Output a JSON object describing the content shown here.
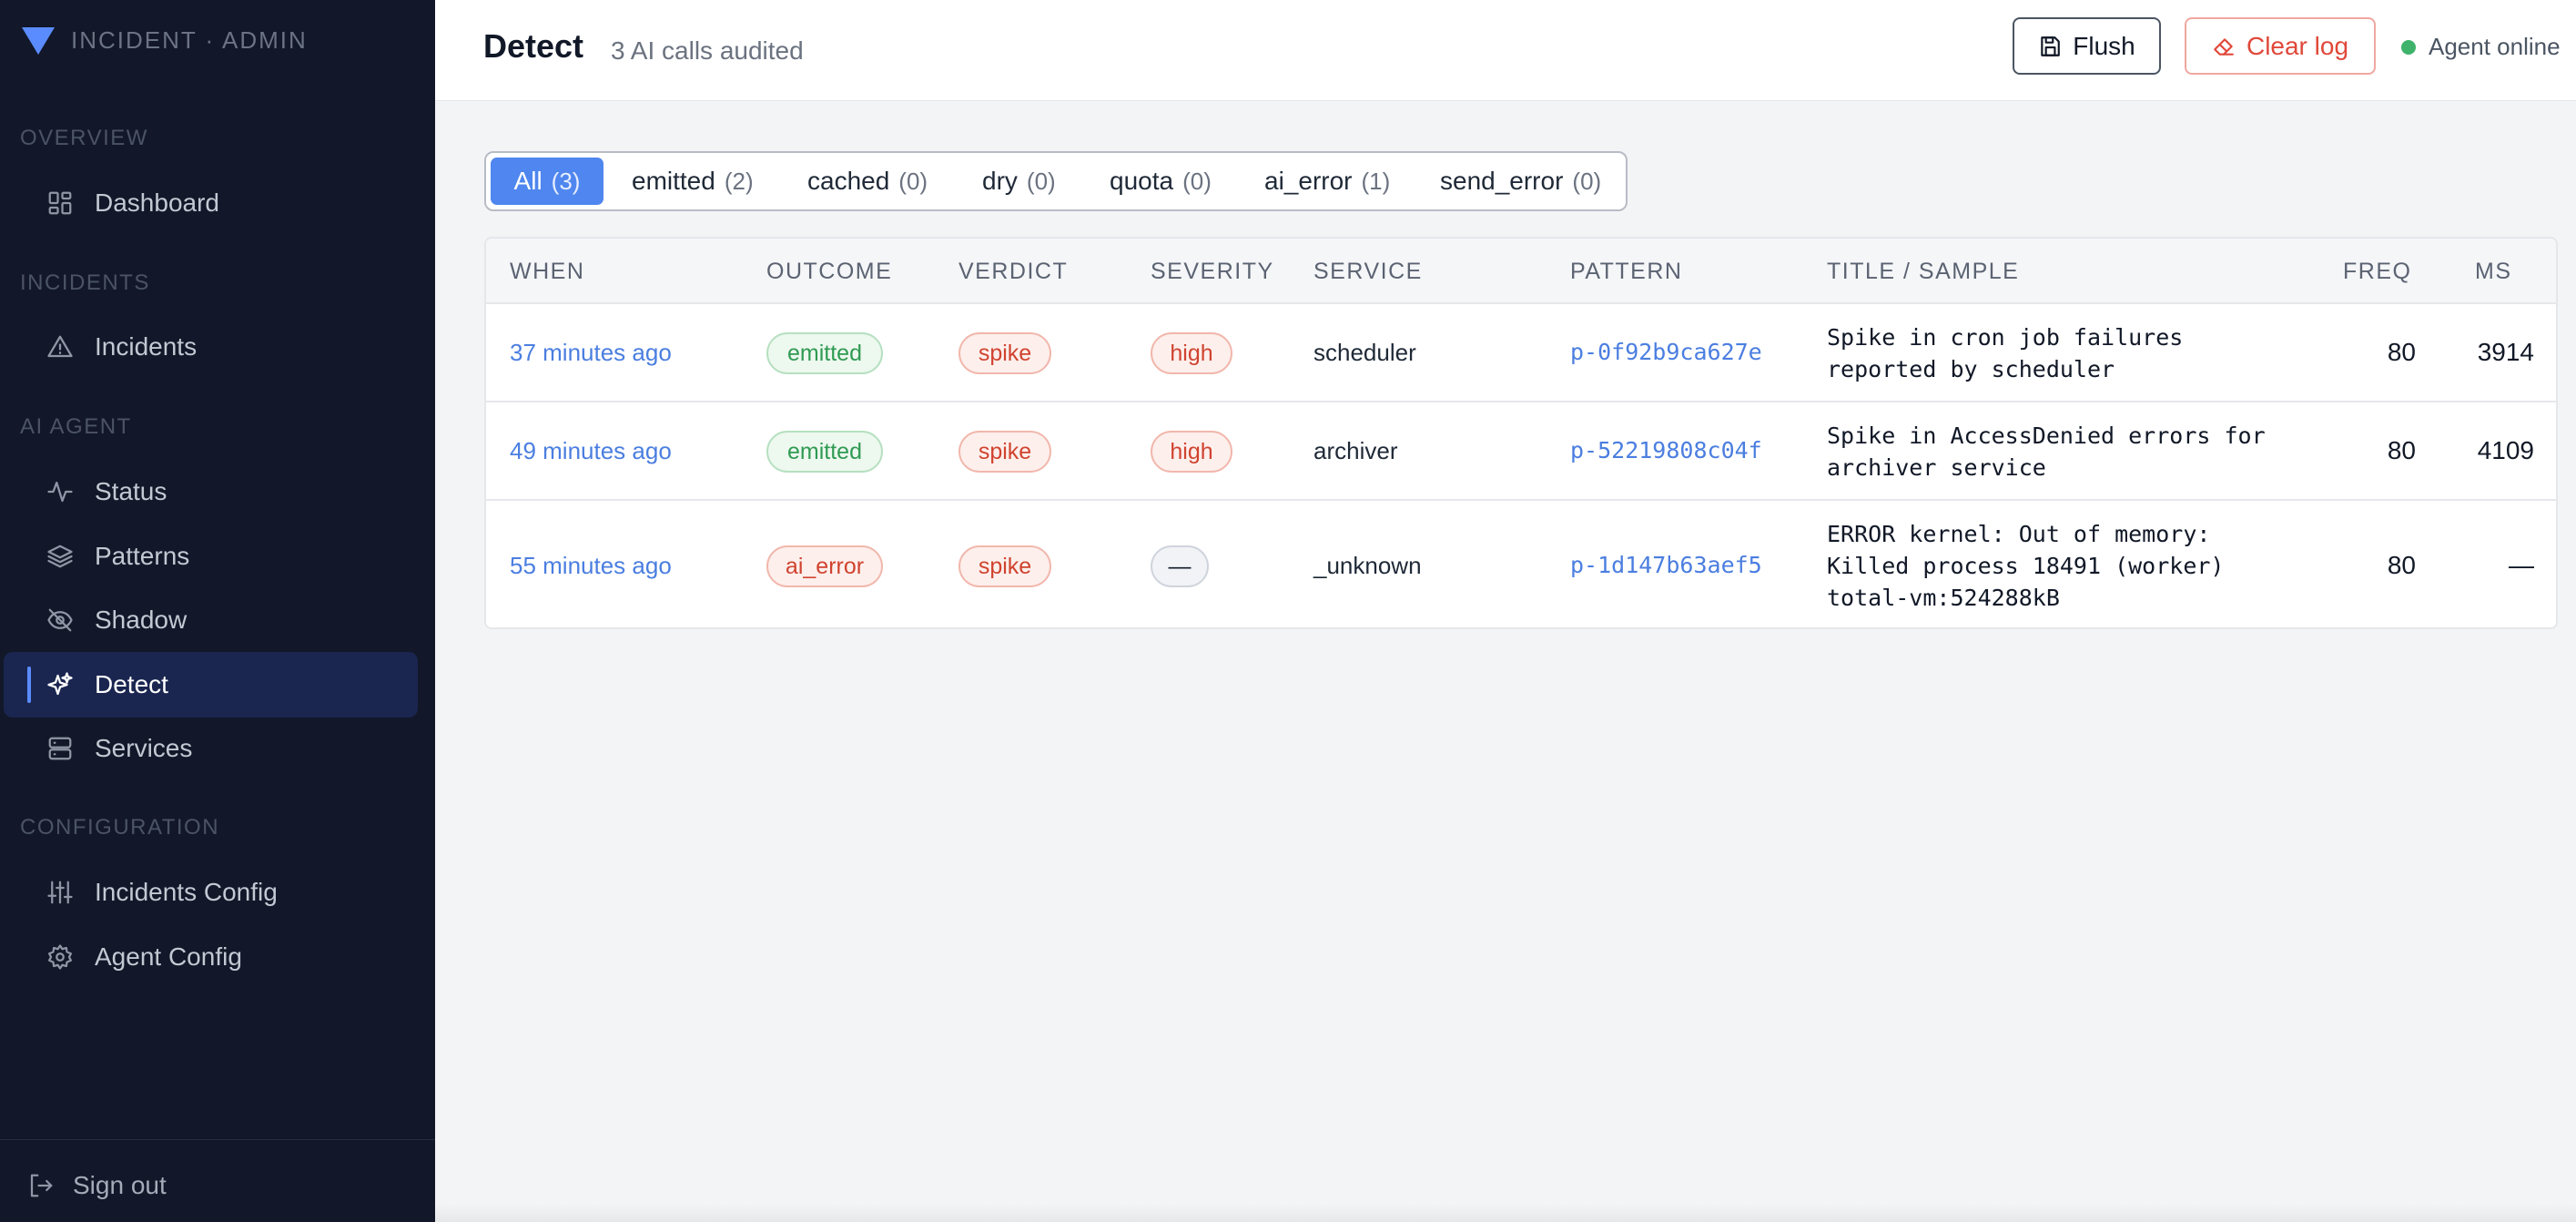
{
  "brand": {
    "text": "INCIDENT · ADMIN",
    "color": "#5b8cff"
  },
  "sidebar": {
    "sections": [
      {
        "title": "OVERVIEW",
        "items": [
          {
            "label": "Dashboard",
            "icon": "grid-icon"
          }
        ]
      },
      {
        "title": "INCIDENTS",
        "items": [
          {
            "label": "Incidents",
            "icon": "alert-triangle-icon"
          }
        ]
      },
      {
        "title": "AI AGENT",
        "items": [
          {
            "label": "Status",
            "icon": "activity-icon"
          },
          {
            "label": "Patterns",
            "icon": "layers-icon"
          },
          {
            "label": "Shadow",
            "icon": "eye-off-icon"
          },
          {
            "label": "Detect",
            "icon": "sparkles-icon",
            "active": true
          },
          {
            "label": "Services",
            "icon": "server-icon"
          }
        ]
      },
      {
        "title": "CONFIGURATION",
        "items": [
          {
            "label": "Incidents Config",
            "icon": "sliders-icon"
          },
          {
            "label": "Agent Config",
            "icon": "gear-icon"
          }
        ]
      }
    ],
    "signout": "Sign out"
  },
  "header": {
    "title": "Detect",
    "subtitle": "3 AI calls audited",
    "flush_label": "Flush",
    "clear_label": "Clear log",
    "agent_status": "Agent online"
  },
  "tabs": [
    {
      "label": "All",
      "count": "(3)",
      "active": true
    },
    {
      "label": "emitted",
      "count": "(2)"
    },
    {
      "label": "cached",
      "count": "(0)"
    },
    {
      "label": "dry",
      "count": "(0)"
    },
    {
      "label": "quota",
      "count": "(0)"
    },
    {
      "label": "ai_error",
      "count": "(1)"
    },
    {
      "label": "send_error",
      "count": "(0)"
    }
  ],
  "table": {
    "columns": [
      "WHEN",
      "OUTCOME",
      "VERDICT",
      "SEVERITY",
      "SERVICE",
      "PATTERN",
      "TITLE / SAMPLE",
      "FREQ",
      "MS"
    ],
    "rows": [
      {
        "when": "37 minutes ago",
        "outcome": "emitted",
        "verdict": "spike",
        "severity": "high",
        "service": "scheduler",
        "pattern": "p-0f92b9ca627e",
        "sample": "Spike in cron job failures\nreported by scheduler",
        "freq": "80",
        "ms": "3914"
      },
      {
        "when": "49 minutes ago",
        "outcome": "emitted",
        "verdict": "spike",
        "severity": "high",
        "service": "archiver",
        "pattern": "p-52219808c04f",
        "sample": "Spike in AccessDenied errors for\narchiver service",
        "freq": "80",
        "ms": "4109"
      },
      {
        "when": "55 minutes ago",
        "outcome": "ai_error",
        "verdict": "spike",
        "severity": "—",
        "service": "_unknown",
        "pattern": "p-1d147b63aef5",
        "sample": "ERROR kernel: Out of memory:\nKilled process 18491 (worker)\ntotal-vm:524288kB",
        "freq": "80",
        "ms": "—"
      }
    ]
  }
}
